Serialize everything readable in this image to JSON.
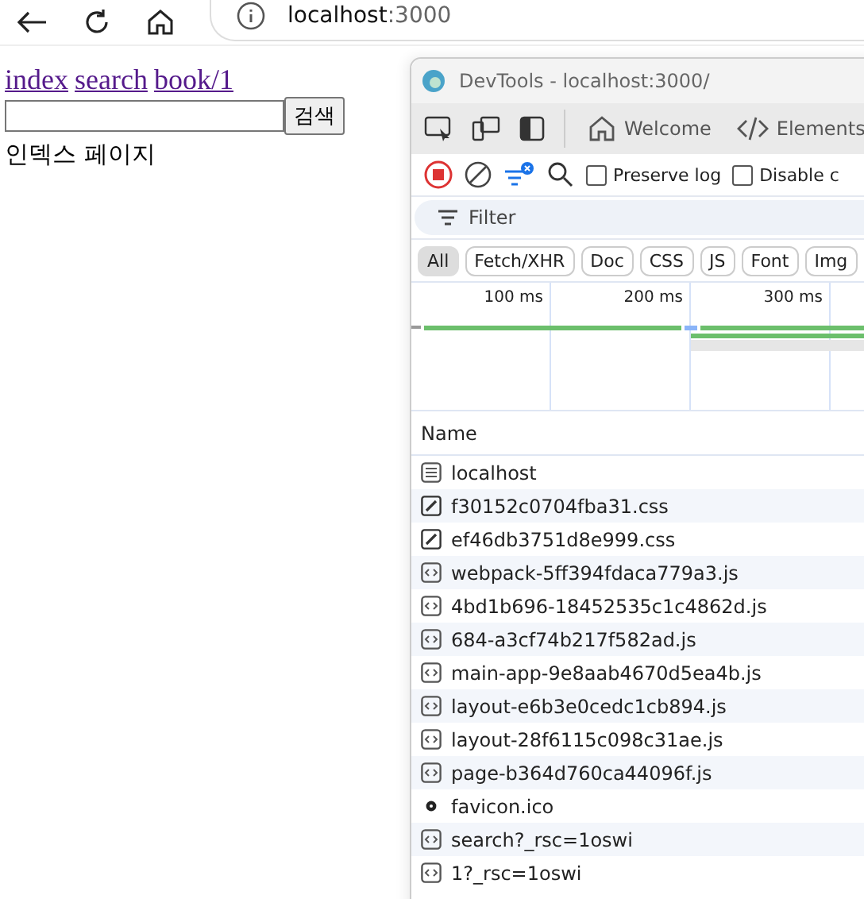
{
  "browser": {
    "address": "localhost",
    "port": ":3000"
  },
  "page": {
    "links": [
      "index",
      "search",
      "book/1"
    ],
    "search_button": "검색",
    "heading": "인덱스 페이지"
  },
  "devtools": {
    "title": "DevTools - localhost:3000/",
    "tabs": [
      {
        "label": "Welcome",
        "kind": "home",
        "selected": false
      },
      {
        "label": "Elements",
        "kind": "code",
        "selected": false
      }
    ],
    "preserve_log": {
      "label": "Preserve log",
      "checked": false
    },
    "disable_cache": {
      "label": "Disable c",
      "checked": false
    },
    "filter": {
      "placeholder": "Filter"
    },
    "chips": [
      {
        "label": "All",
        "selected": true
      },
      {
        "label": "Fetch/XHR",
        "selected": false
      },
      {
        "label": "Doc",
        "selected": false
      },
      {
        "label": "CSS",
        "selected": false
      },
      {
        "label": "JS",
        "selected": false
      },
      {
        "label": "Font",
        "selected": false
      },
      {
        "label": "Img",
        "selected": false
      }
    ],
    "timeline_ticks": [
      "100 ms",
      "200 ms",
      "300 ms"
    ],
    "column": "Name",
    "requests": [
      {
        "name": "localhost",
        "kind": "doc"
      },
      {
        "name": "f30152c0704fba31.css",
        "kind": "css"
      },
      {
        "name": "ef46db3751d8e999.css",
        "kind": "css"
      },
      {
        "name": "webpack-5ff394fdaca779a3.js",
        "kind": "js"
      },
      {
        "name": "4bd1b696-18452535c1c4862d.js",
        "kind": "js"
      },
      {
        "name": "684-a3cf74b217f582ad.js",
        "kind": "js"
      },
      {
        "name": "main-app-9e8aab4670d5ea4b.js",
        "kind": "js"
      },
      {
        "name": "layout-e6b3e0cedc1cb894.js",
        "kind": "js"
      },
      {
        "name": "layout-28f6115c098c31ae.js",
        "kind": "js"
      },
      {
        "name": "page-b364d760ca44096f.js",
        "kind": "js"
      },
      {
        "name": "favicon.ico",
        "kind": "icon"
      },
      {
        "name": "search?_rsc=1oswi",
        "kind": "js"
      },
      {
        "name": "1?_rsc=1oswi",
        "kind": "js"
      }
    ]
  }
}
